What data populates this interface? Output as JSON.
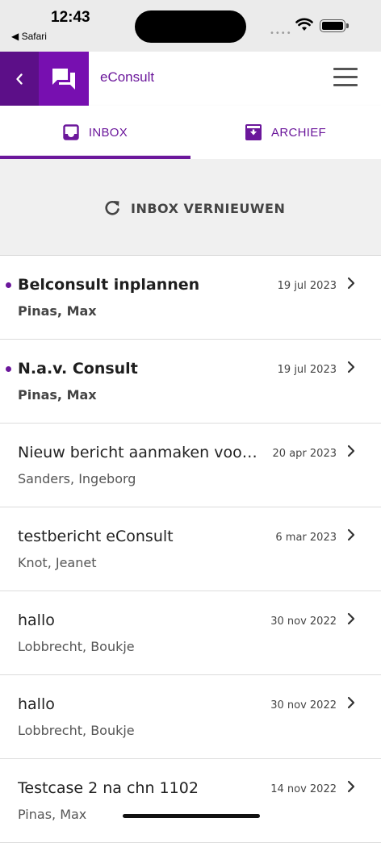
{
  "status_bar": {
    "time": "12:43",
    "back_app": "◀ Safari",
    "signal": "••••"
  },
  "app_bar": {
    "title": "eConsult"
  },
  "tabs": [
    {
      "label": "INBOX",
      "icon": "inbox-icon",
      "active": true
    },
    {
      "label": "ARCHIEF",
      "icon": "archive-icon",
      "active": false
    }
  ],
  "refresh": {
    "label": "INBOX VERNIEUWEN"
  },
  "messages": [
    {
      "subject": "Belconsult inplannen",
      "sender": "Pinas, Max",
      "date": "19 jul 2023",
      "unread": true
    },
    {
      "subject": "N.a.v. Consult",
      "sender": "Pinas, Max",
      "date": "19 jul 2023",
      "unread": true
    },
    {
      "subject": "Nieuw bericht aanmaken voor…",
      "sender": "Sanders, Ingeborg",
      "date": "20 apr 2023",
      "unread": false
    },
    {
      "subject": "testbericht eConsult",
      "sender": "Knot, Jeanet",
      "date": "6 mar 2023",
      "unread": false
    },
    {
      "subject": "hallo",
      "sender": "Lobbrecht, Boukje",
      "date": "30 nov 2022",
      "unread": false
    },
    {
      "subject": "hallo",
      "sender": "Lobbrecht, Boukje",
      "date": "30 nov 2022",
      "unread": false
    },
    {
      "subject": "Testcase 2 na chn 1102",
      "sender": "Pinas, Max",
      "date": "14 nov 2022",
      "unread": false
    }
  ],
  "colors": {
    "accent": "#6b179b",
    "back_button": "#5c0f88",
    "app_icon_bg": "#770fb0"
  }
}
